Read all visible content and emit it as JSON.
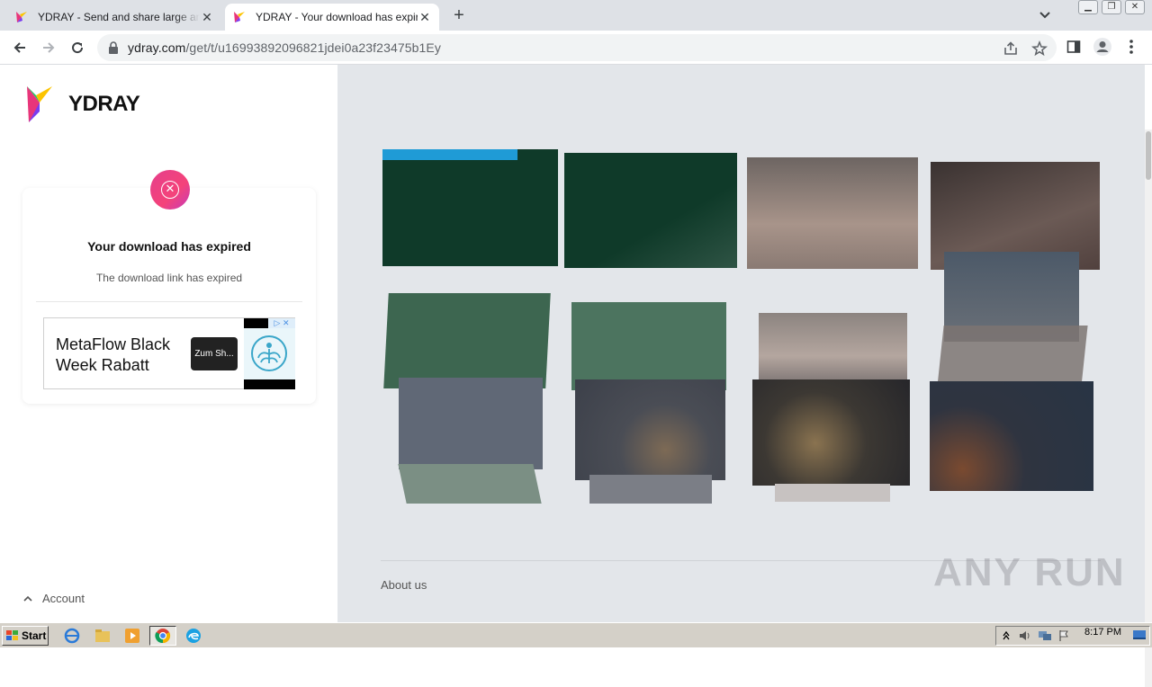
{
  "browser": {
    "tabs": [
      {
        "title": "YDRAY - Send and share large and big files",
        "active": false
      },
      {
        "title": "YDRAY - Your download has expired",
        "active": true
      }
    ],
    "url_host": "ydray.com",
    "url_path": "/get/t/u16993892096821jdei0a23f23475b1Ey"
  },
  "page": {
    "logo_text": "YDRAY",
    "card": {
      "title": "Your download has expired",
      "subtitle": "The download link has expired"
    },
    "ad": {
      "text": "MetaFlow Black Week Rabatt",
      "button": "Zum Sh..."
    },
    "account_label": "Account",
    "about_label": "About us",
    "watermark": "ANY RUN"
  },
  "taskbar": {
    "start_label": "Start",
    "clock": "8:17 PM"
  },
  "colors": {
    "accent_pink": "#e83f86",
    "page_bg": "#e3e6ea"
  }
}
